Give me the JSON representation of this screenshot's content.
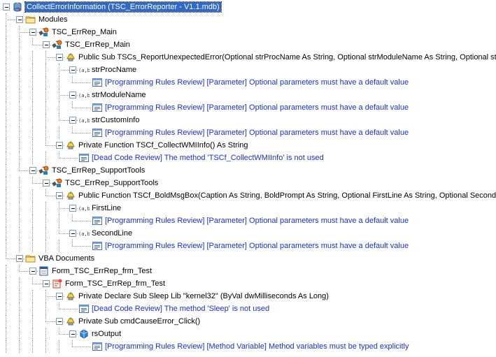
{
  "window": {
    "title": "CollectErrorInformation (TSC_ErrorReporter - V1.1.mdb)"
  },
  "tree": {
    "nodes": [
      {
        "label": "CollectErrorInformation (TSC_ErrorReporter - V1.1.mdb)",
        "level": 0,
        "icon": "database-icon",
        "type": "root",
        "expanded": true,
        "selected": true
      },
      {
        "label": "Modules",
        "level": 1,
        "icon": "folder-icon",
        "type": "folder",
        "expanded": true
      },
      {
        "label": "TSC_ErrRep_Main",
        "level": 2,
        "icon": "module-icon",
        "type": "module",
        "expanded": true
      },
      {
        "label": "TSC_ErrRep_Main",
        "level": 3,
        "icon": "module-icon",
        "type": "module",
        "expanded": true
      },
      {
        "label": "Public Sub TSCs_ReportUnexpectedError(Optional strProcName As String, Optional strModuleName As String, Optional strCust",
        "level": 4,
        "icon": "method-icon",
        "type": "method",
        "expanded": true
      },
      {
        "label": "strProcName",
        "level": 5,
        "icon": "parameter-icon",
        "type": "parameter",
        "expanded": true
      },
      {
        "label": "[Programming Rules Review] [Parameter] Optional parameters must have a default value",
        "level": 6,
        "icon": "issue-icon",
        "type": "issue"
      },
      {
        "label": "strModuleName",
        "level": 5,
        "icon": "parameter-icon",
        "type": "parameter",
        "expanded": true
      },
      {
        "label": "[Programming Rules Review] [Parameter] Optional parameters must have a default value",
        "level": 6,
        "icon": "issue-icon",
        "type": "issue"
      },
      {
        "label": "strCustomInfo",
        "level": 5,
        "icon": "parameter-icon",
        "type": "parameter",
        "expanded": true
      },
      {
        "label": "[Programming Rules Review] [Parameter] Optional parameters must have a default value",
        "level": 6,
        "icon": "issue-icon",
        "type": "issue"
      },
      {
        "label": "Private Function TSCf_CollectWMIInfo() As String",
        "level": 4,
        "icon": "method-icon",
        "type": "method",
        "expanded": true
      },
      {
        "label": "[Dead Code Review] The method 'TSCf_CollectWMIInfo' is not used",
        "level": 5,
        "icon": "issue-icon",
        "type": "issue"
      },
      {
        "label": "TSC_ErrRep_SupportTools",
        "level": 2,
        "icon": "module-icon",
        "type": "module",
        "expanded": true
      },
      {
        "label": "TSC_ErrRep_SupportTools",
        "level": 3,
        "icon": "module-icon",
        "type": "module",
        "expanded": true
      },
      {
        "label": "Public Function TSCf_BoldMsgBox(Caption As String, BoldPrompt As String, Optional FirstLine As String, Optional SecondLine",
        "level": 4,
        "icon": "method-icon",
        "type": "method",
        "expanded": true
      },
      {
        "label": "FirstLine",
        "level": 5,
        "icon": "parameter-icon",
        "type": "parameter",
        "expanded": true
      },
      {
        "label": "[Programming Rules Review] [Parameter] Optional parameters must have a default value",
        "level": 6,
        "icon": "issue-icon",
        "type": "issue"
      },
      {
        "label": "SecondLine",
        "level": 5,
        "icon": "parameter-icon",
        "type": "parameter",
        "expanded": true
      },
      {
        "label": "[Programming Rules Review] [Parameter] Optional parameters must have a default value",
        "level": 6,
        "icon": "issue-icon",
        "type": "issue"
      },
      {
        "label": "VBA Documents",
        "level": 1,
        "icon": "folder-icon",
        "type": "folder",
        "expanded": true
      },
      {
        "label": "Form_TSC_ErrRep_frm_Test",
        "level": 2,
        "icon": "form-icon",
        "type": "form",
        "expanded": true
      },
      {
        "label": "Form_TSC_ErrRep_frm_Test",
        "level": 3,
        "icon": "class-module-icon",
        "type": "module",
        "expanded": true
      },
      {
        "label": "Private Declare Sub Sleep Lib \"kernel32\" (ByVal dwMilliseconds As Long)",
        "level": 4,
        "icon": "method-icon",
        "type": "method",
        "expanded": true
      },
      {
        "label": "[Dead Code Review] The method 'Sleep' is not used",
        "level": 5,
        "icon": "issue-icon",
        "type": "issue"
      },
      {
        "label": "Private Sub cmdCauseError_Click()",
        "level": 4,
        "icon": "method-icon",
        "type": "method",
        "expanded": true
      },
      {
        "label": "rsOutput",
        "level": 5,
        "icon": "variable-icon",
        "type": "variable",
        "expanded": true
      },
      {
        "label": "[Programming Rules Review] [Method Variable] Method variables must be typed explicitly",
        "level": 6,
        "icon": "issue-icon",
        "type": "issue"
      }
    ]
  }
}
